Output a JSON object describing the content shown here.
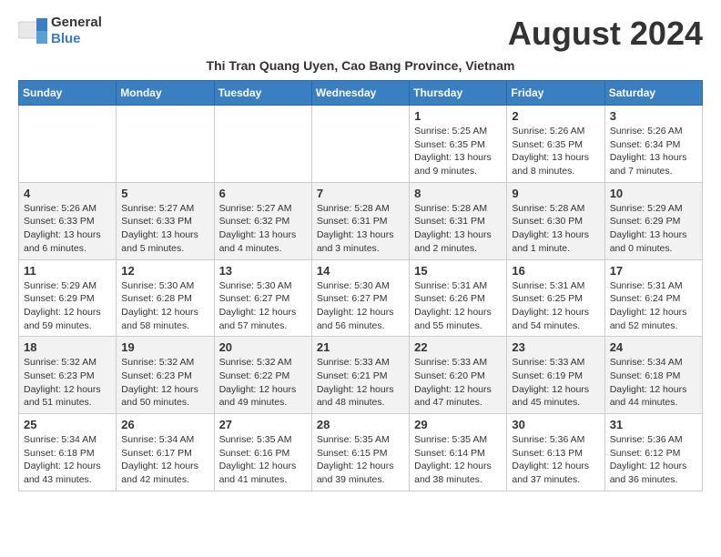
{
  "logo": {
    "text_general": "General",
    "text_blue": "Blue"
  },
  "month_title": "August 2024",
  "subtitle": "Thi Tran Quang Uyen, Cao Bang Province, Vietnam",
  "days_of_week": [
    "Sunday",
    "Monday",
    "Tuesday",
    "Wednesday",
    "Thursday",
    "Friday",
    "Saturday"
  ],
  "weeks": [
    [
      {
        "day": "",
        "info": ""
      },
      {
        "day": "",
        "info": ""
      },
      {
        "day": "",
        "info": ""
      },
      {
        "day": "",
        "info": ""
      },
      {
        "day": "1",
        "info": "Sunrise: 5:25 AM\nSunset: 6:35 PM\nDaylight: 13 hours\nand 9 minutes."
      },
      {
        "day": "2",
        "info": "Sunrise: 5:26 AM\nSunset: 6:35 PM\nDaylight: 13 hours\nand 8 minutes."
      },
      {
        "day": "3",
        "info": "Sunrise: 5:26 AM\nSunset: 6:34 PM\nDaylight: 13 hours\nand 7 minutes."
      }
    ],
    [
      {
        "day": "4",
        "info": "Sunrise: 5:26 AM\nSunset: 6:33 PM\nDaylight: 13 hours\nand 6 minutes."
      },
      {
        "day": "5",
        "info": "Sunrise: 5:27 AM\nSunset: 6:33 PM\nDaylight: 13 hours\nand 5 minutes."
      },
      {
        "day": "6",
        "info": "Sunrise: 5:27 AM\nSunset: 6:32 PM\nDaylight: 13 hours\nand 4 minutes."
      },
      {
        "day": "7",
        "info": "Sunrise: 5:28 AM\nSunset: 6:31 PM\nDaylight: 13 hours\nand 3 minutes."
      },
      {
        "day": "8",
        "info": "Sunrise: 5:28 AM\nSunset: 6:31 PM\nDaylight: 13 hours\nand 2 minutes."
      },
      {
        "day": "9",
        "info": "Sunrise: 5:28 AM\nSunset: 6:30 PM\nDaylight: 13 hours\nand 1 minute."
      },
      {
        "day": "10",
        "info": "Sunrise: 5:29 AM\nSunset: 6:29 PM\nDaylight: 13 hours\nand 0 minutes."
      }
    ],
    [
      {
        "day": "11",
        "info": "Sunrise: 5:29 AM\nSunset: 6:29 PM\nDaylight: 12 hours\nand 59 minutes."
      },
      {
        "day": "12",
        "info": "Sunrise: 5:30 AM\nSunset: 6:28 PM\nDaylight: 12 hours\nand 58 minutes."
      },
      {
        "day": "13",
        "info": "Sunrise: 5:30 AM\nSunset: 6:27 PM\nDaylight: 12 hours\nand 57 minutes."
      },
      {
        "day": "14",
        "info": "Sunrise: 5:30 AM\nSunset: 6:27 PM\nDaylight: 12 hours\nand 56 minutes."
      },
      {
        "day": "15",
        "info": "Sunrise: 5:31 AM\nSunset: 6:26 PM\nDaylight: 12 hours\nand 55 minutes."
      },
      {
        "day": "16",
        "info": "Sunrise: 5:31 AM\nSunset: 6:25 PM\nDaylight: 12 hours\nand 54 minutes."
      },
      {
        "day": "17",
        "info": "Sunrise: 5:31 AM\nSunset: 6:24 PM\nDaylight: 12 hours\nand 52 minutes."
      }
    ],
    [
      {
        "day": "18",
        "info": "Sunrise: 5:32 AM\nSunset: 6:23 PM\nDaylight: 12 hours\nand 51 minutes."
      },
      {
        "day": "19",
        "info": "Sunrise: 5:32 AM\nSunset: 6:23 PM\nDaylight: 12 hours\nand 50 minutes."
      },
      {
        "day": "20",
        "info": "Sunrise: 5:32 AM\nSunset: 6:22 PM\nDaylight: 12 hours\nand 49 minutes."
      },
      {
        "day": "21",
        "info": "Sunrise: 5:33 AM\nSunset: 6:21 PM\nDaylight: 12 hours\nand 48 minutes."
      },
      {
        "day": "22",
        "info": "Sunrise: 5:33 AM\nSunset: 6:20 PM\nDaylight: 12 hours\nand 47 minutes."
      },
      {
        "day": "23",
        "info": "Sunrise: 5:33 AM\nSunset: 6:19 PM\nDaylight: 12 hours\nand 45 minutes."
      },
      {
        "day": "24",
        "info": "Sunrise: 5:34 AM\nSunset: 6:18 PM\nDaylight: 12 hours\nand 44 minutes."
      }
    ],
    [
      {
        "day": "25",
        "info": "Sunrise: 5:34 AM\nSunset: 6:18 PM\nDaylight: 12 hours\nand 43 minutes."
      },
      {
        "day": "26",
        "info": "Sunrise: 5:34 AM\nSunset: 6:17 PM\nDaylight: 12 hours\nand 42 minutes."
      },
      {
        "day": "27",
        "info": "Sunrise: 5:35 AM\nSunset: 6:16 PM\nDaylight: 12 hours\nand 41 minutes."
      },
      {
        "day": "28",
        "info": "Sunrise: 5:35 AM\nSunset: 6:15 PM\nDaylight: 12 hours\nand 39 minutes."
      },
      {
        "day": "29",
        "info": "Sunrise: 5:35 AM\nSunset: 6:14 PM\nDaylight: 12 hours\nand 38 minutes."
      },
      {
        "day": "30",
        "info": "Sunrise: 5:36 AM\nSunset: 6:13 PM\nDaylight: 12 hours\nand 37 minutes."
      },
      {
        "day": "31",
        "info": "Sunrise: 5:36 AM\nSunset: 6:12 PM\nDaylight: 12 hours\nand 36 minutes."
      }
    ]
  ]
}
